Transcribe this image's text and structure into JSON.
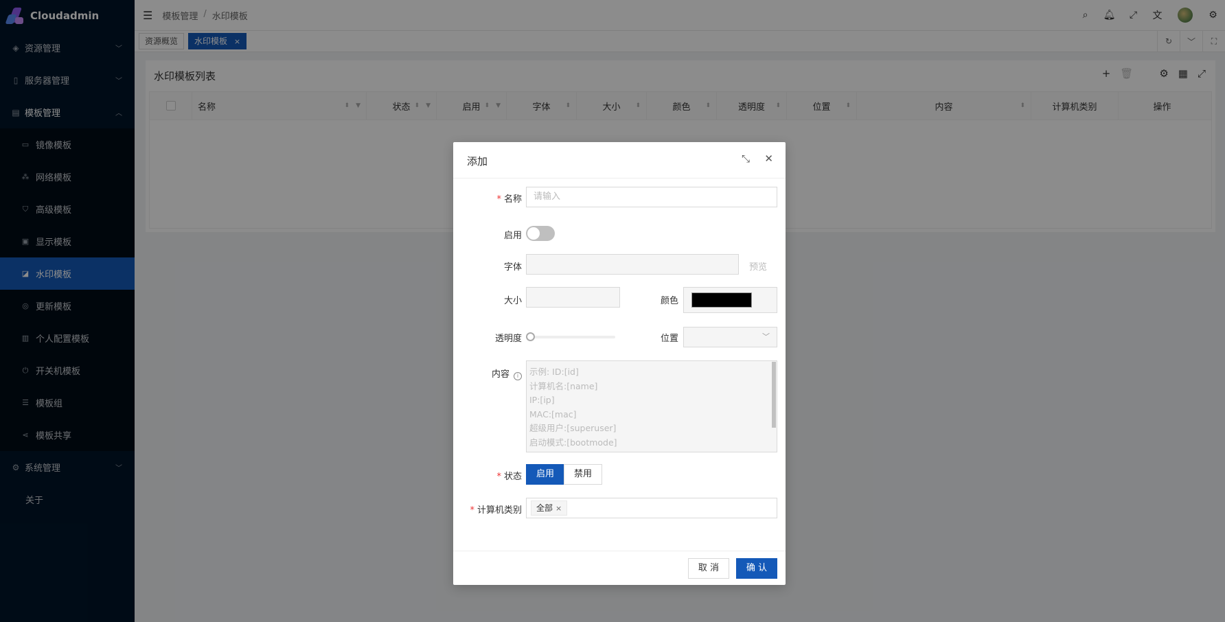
{
  "app": {
    "title": "Cloudadmin"
  },
  "sidebar": {
    "groups": [
      {
        "label": "资源管理",
        "icon": "resource-icon"
      },
      {
        "label": "服务器管理",
        "icon": "server-icon"
      },
      {
        "label": "模板管理",
        "icon": "template-icon"
      }
    ],
    "template_items": [
      {
        "label": "镜像模板",
        "icon": "disk-icon"
      },
      {
        "label": "网络模板",
        "icon": "network-icon"
      },
      {
        "label": "高级模板",
        "icon": "advanced-icon"
      },
      {
        "label": "显示模板",
        "icon": "display-icon"
      },
      {
        "label": "水印模板",
        "icon": "watermark-icon"
      },
      {
        "label": "更新模板",
        "icon": "update-icon"
      },
      {
        "label": "个人配置模板",
        "icon": "profile-icon"
      },
      {
        "label": "开关机模板",
        "icon": "power-icon"
      },
      {
        "label": "模板组",
        "icon": "group-icon"
      },
      {
        "label": "模板共享",
        "icon": "share-icon"
      }
    ],
    "system": {
      "label": "系统管理",
      "icon": "settings-icon"
    },
    "about": "关于"
  },
  "header": {
    "breadcrumb": [
      "模板管理",
      "水印模板"
    ],
    "breadcrumb_sep": "/"
  },
  "tabs": [
    {
      "label": "资源概览"
    },
    {
      "label": "水印模板",
      "close": "×"
    }
  ],
  "card": {
    "title": "水印模板列表",
    "add": "+",
    "columns": [
      "名称",
      "状态",
      "启用",
      "字体",
      "大小",
      "颜色",
      "透明度",
      "位置",
      "内容",
      "计算机类别",
      "操作"
    ]
  },
  "modal": {
    "title": "添加",
    "fields": {
      "name": {
        "label": "名称",
        "placeholder": "请输入"
      },
      "enabled": {
        "label": "启用",
        "value": false
      },
      "font": {
        "label": "字体",
        "preview": "预览"
      },
      "size": {
        "label": "大小"
      },
      "color": {
        "label": "颜色",
        "value": "#000000"
      },
      "opacity": {
        "label": "透明度",
        "value": 0
      },
      "position": {
        "label": "位置"
      },
      "content": {
        "label": "内容",
        "placeholder_lines": [
          "示例:  ID:[id]",
          "计算机名:[name]",
          "IP:[ip]",
          "MAC:[mac]",
          "超级用户:[superuser]",
          "启动模式:[bootmode]"
        ]
      },
      "status": {
        "label": "状态",
        "options": [
          "启用",
          "禁用"
        ],
        "selected": "启用"
      },
      "computer_type": {
        "label": "计算机类别",
        "tags": [
          "全部"
        ]
      }
    },
    "cancel": "取 消",
    "confirm": "确 认"
  },
  "colors": {
    "sidebar_bg": "#001529",
    "primary": "#1459b8",
    "required": "#e33333"
  }
}
